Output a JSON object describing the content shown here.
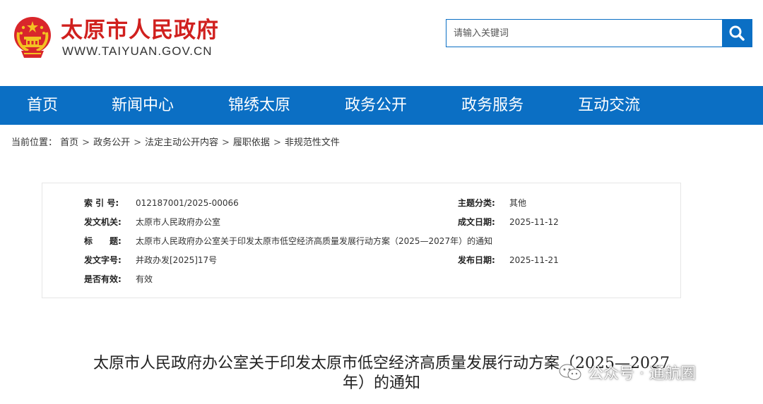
{
  "header": {
    "site_title": "太原市人民政府",
    "site_url": "WWW.TAIYUAN.GOV.CN",
    "search_placeholder": "请输入关键词"
  },
  "nav": {
    "items": [
      "首页",
      "新闻中心",
      "锦绣太原",
      "政务公开",
      "政务服务",
      "互动交流"
    ]
  },
  "breadcrumb": {
    "prefix": "当前位置：",
    "items": [
      "首页",
      "政务公开",
      "法定主动公开内容",
      "履职依据",
      "非规范性文件"
    ],
    "separator": ">"
  },
  "meta": {
    "index_label": "索 引 号:",
    "index_value": "012187001/2025-00066",
    "topic_label": "主题分类:",
    "topic_value": "其他",
    "issuer_label": "发文机关:",
    "issuer_value": "太原市人民政府办公室",
    "date_made_label": "成文日期:",
    "date_made_value": "2025-11-12",
    "title_label": "标　　题:",
    "title_value": "太原市人民政府办公室关于印发太原市低空经济高质量发展行动方案（2025—2027年）的通知",
    "doc_no_label": "发文字号:",
    "doc_no_value": "并政办发[2025]17号",
    "publish_label": "发布日期:",
    "publish_value": "2025-11-21",
    "valid_label": "是否有效:",
    "valid_value": "有效"
  },
  "article": {
    "title_line1": "太原市人民政府办公室关于印发太原市低空经济高质量发展行动方案（2025—2027",
    "title_line2": "年）的通知"
  },
  "watermark": {
    "text": "公众号 · 通航圈"
  },
  "colors": {
    "brand_blue": "#0b6fc4",
    "title_red": "#d0201e"
  }
}
